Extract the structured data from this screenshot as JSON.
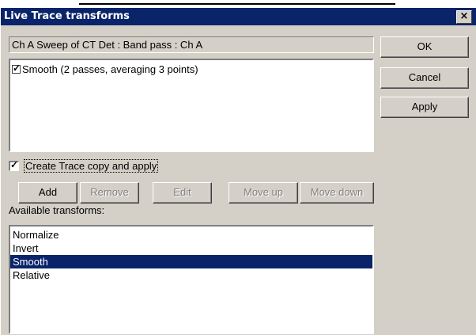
{
  "window": {
    "title": "Live Trace transforms",
    "close_glyph": "×"
  },
  "source": {
    "text": "Ch A Sweep of CT Det : Band pass : Ch A"
  },
  "applied_transforms": [
    {
      "label": "Smooth (2 passes, averaging 3 points)",
      "checked": true
    }
  ],
  "copy_option": {
    "label": "Create Trace copy and apply",
    "checked": true
  },
  "buttons": {
    "ok": "OK",
    "cancel": "Cancel",
    "apply": "Apply",
    "add": "Add",
    "remove": "Remove",
    "edit": "Edit",
    "move_up": "Move up",
    "move_down": "Move down"
  },
  "available": {
    "label": "Available transforms:",
    "items": [
      {
        "label": "Normalize",
        "selected": false
      },
      {
        "label": "Invert",
        "selected": false
      },
      {
        "label": "Smooth",
        "selected": true
      },
      {
        "label": "Relative",
        "selected": false
      }
    ]
  },
  "colors": {
    "titlebar": "#0a246a",
    "dialog_face": "#d4d0c8",
    "selection": "#0a246a"
  }
}
